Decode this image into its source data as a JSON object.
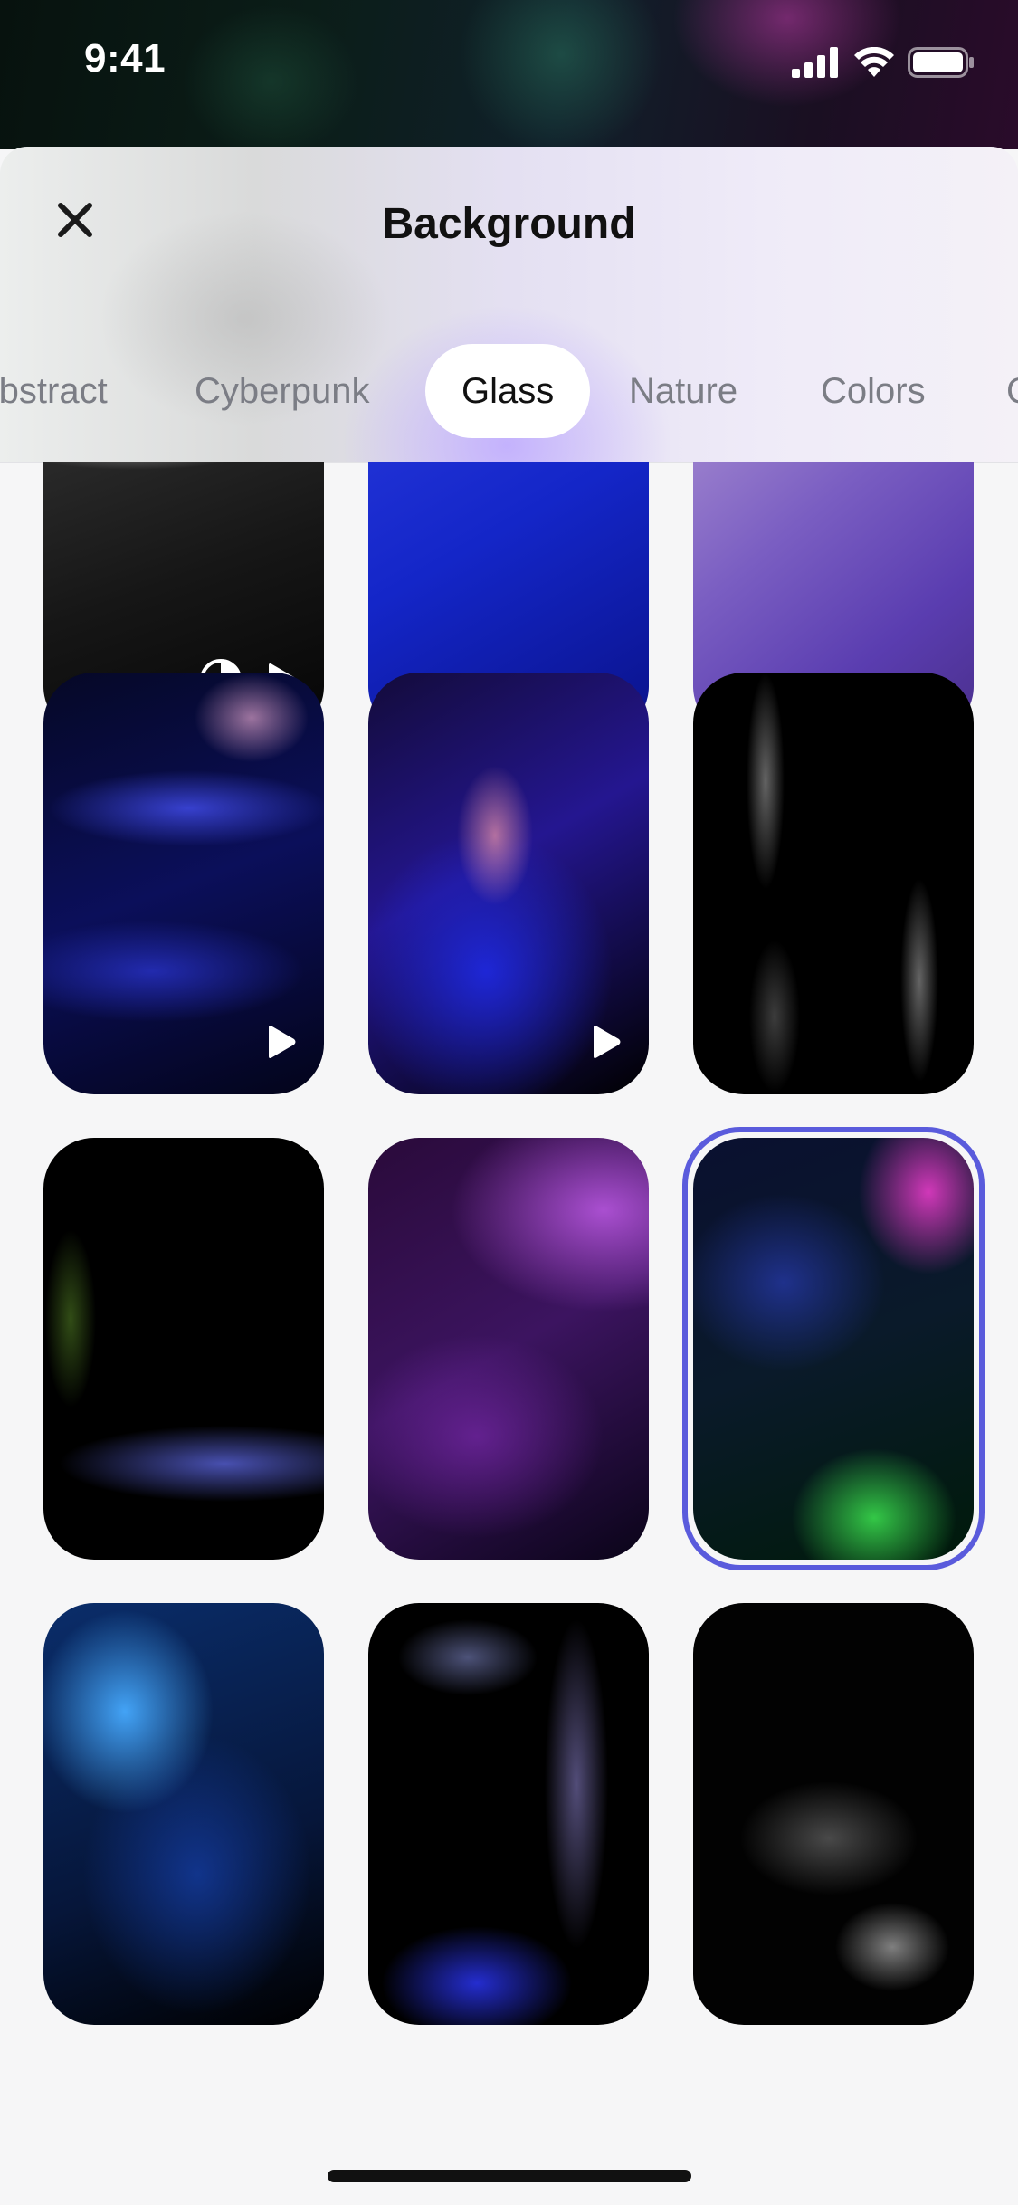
{
  "status_bar": {
    "time": "9:41",
    "icons": [
      "cellular-signal-icon",
      "wifi-icon",
      "battery-icon"
    ]
  },
  "header": {
    "title": "Background",
    "close_icon": "close-icon"
  },
  "tabs": [
    {
      "label": "Abstract",
      "active": false
    },
    {
      "label": "Cyberpunk",
      "active": false
    },
    {
      "label": "Glass",
      "active": true
    },
    {
      "label": "Nature",
      "active": false
    },
    {
      "label": "Colors",
      "active": false
    },
    {
      "label": "C",
      "active": false
    }
  ],
  "wallpapers": [
    {
      "row": 0,
      "col": 0,
      "badges": [
        "contrast-icon",
        "play-icon"
      ],
      "selected": false
    },
    {
      "row": 0,
      "col": 1,
      "badges": [],
      "selected": false
    },
    {
      "row": 0,
      "col": 2,
      "badges": [],
      "selected": false
    },
    {
      "row": 1,
      "col": 0,
      "badges": [
        "play-icon"
      ],
      "selected": false
    },
    {
      "row": 1,
      "col": 1,
      "badges": [
        "play-icon"
      ],
      "selected": false
    },
    {
      "row": 1,
      "col": 2,
      "badges": [],
      "selected": false
    },
    {
      "row": 2,
      "col": 0,
      "badges": [],
      "selected": false
    },
    {
      "row": 2,
      "col": 1,
      "badges": [],
      "selected": false
    },
    {
      "row": 2,
      "col": 2,
      "badges": [],
      "selected": true
    },
    {
      "row": 3,
      "col": 0,
      "badges": [],
      "selected": false
    },
    {
      "row": 3,
      "col": 1,
      "badges": [],
      "selected": false
    },
    {
      "row": 3,
      "col": 2,
      "badges": [],
      "selected": false
    }
  ],
  "colors": {
    "accent_selection": "#5a5bdc",
    "tab_active_bg": "#ffffff",
    "tab_inactive_text": "#7b7d85",
    "page_bg": "#f6f6f7"
  }
}
